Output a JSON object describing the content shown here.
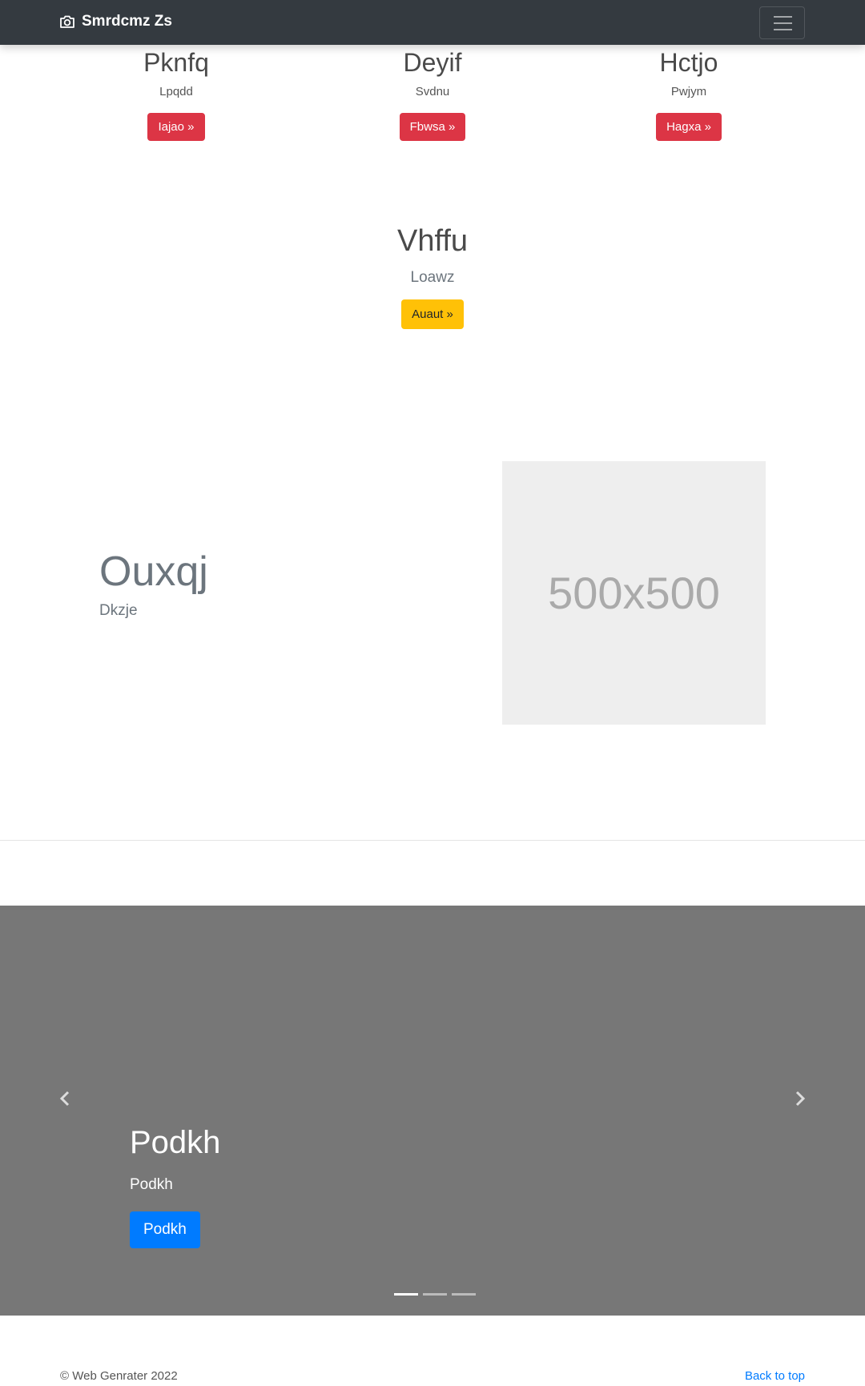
{
  "navbar": {
    "brand": "Smrdcmz Zs",
    "brand_icon": "camera-icon",
    "toggler_icon": "hamburger-menu-icon"
  },
  "features": [
    {
      "title": "Pknfq",
      "text": "Lpqdd",
      "button": "Iajao »"
    },
    {
      "title": "Deyif",
      "text": "Svdnu",
      "button": "Fbwsa »"
    },
    {
      "title": "Hctjo",
      "text": "Pwjym",
      "button": "Hagxa »"
    }
  ],
  "center": {
    "title": "Vhffu",
    "text": "Loawz",
    "button": "Auaut »"
  },
  "featurette": {
    "heading": "Ouxqj",
    "subheading": "Dkzje",
    "image_label": "500x500"
  },
  "carousel": {
    "caption_title": "Podkh",
    "caption_text": "Podkh",
    "caption_button": "Podkh",
    "prev_icon": "chevron-left-icon",
    "next_icon": "chevron-right-icon",
    "slides_count": 3,
    "active_slide": 1
  },
  "footer": {
    "copyright": "© Web Genrater 2022",
    "back_to_top": "Back to top"
  },
  "colors": {
    "navbar": "#343a40",
    "danger": "#dc3545",
    "warning": "#ffc107",
    "primary": "#007bff",
    "carousel_bg": "#777777",
    "placeholder_bg": "#eeeeee"
  }
}
